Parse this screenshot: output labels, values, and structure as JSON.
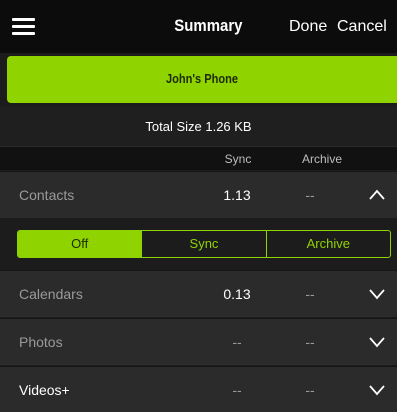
{
  "header": {
    "title": "Summary",
    "done_label": "Done",
    "cancel_label": "Cancel",
    "menu_icon": "hamburger-menu-icon"
  },
  "device": {
    "name": "John's Phone"
  },
  "summary": {
    "total_size": "Total Size 1.26 KB"
  },
  "columns": {
    "sync": "Sync",
    "archive": "Archive"
  },
  "rows": [
    {
      "label": "Contacts",
      "sync": "1.13",
      "archive": "--",
      "chevron": "chevron-up-icon",
      "expanded": true
    },
    {
      "label": "Calendars",
      "sync": "0.13",
      "archive": "--",
      "chevron": "chevron-down-icon",
      "expanded": false
    },
    {
      "label": "Photos",
      "sync": "--",
      "archive": "--",
      "chevron": "chevron-down-icon",
      "expanded": false
    },
    {
      "label": "Videos+",
      "sync": "--",
      "archive": "--",
      "chevron": "chevron-down-icon",
      "expanded": false
    }
  ],
  "segmented_control": {
    "options": [
      "Off",
      "Sync",
      "Archive"
    ],
    "selected": "Off"
  },
  "colors": {
    "accent": "#8fd400",
    "background": "#1c1c1c",
    "row_background": "#2b2b2b",
    "topbar": "#0c0c0c"
  }
}
